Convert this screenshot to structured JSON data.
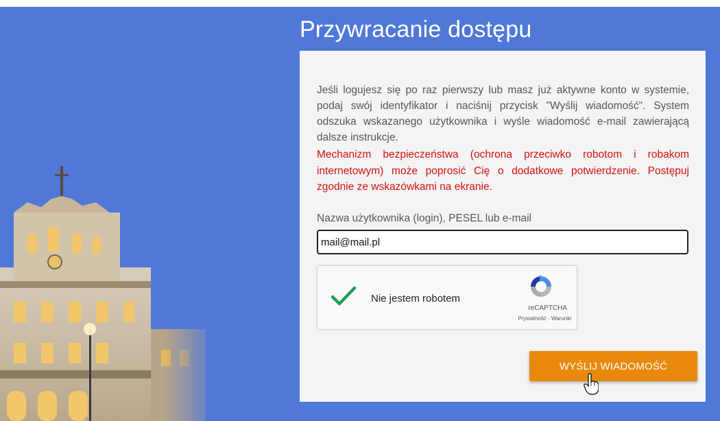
{
  "page": {
    "title": "Przywracanie dostępu",
    "intro_text": "Jeśli logujesz się po raz pierwszy lub masz już aktywne konto w systemie, podaj swój identyfikator i naciśnij przycisk \"Wyślij wiadomość\". System odszuka wskazanego użytkownika i wyśle wiadomość e-mail zawierającą dalsze instrukcje.",
    "warning_text": "Mechanizm bezpieczeństwa (ochrona przeciwko robotom i robakom internetowym) może poprosić Cię o dodatkowe potwierdzenie. Postępuj zgodnie ze wskazówkami na ekranie."
  },
  "form": {
    "login_label": "Nazwa użytkownika (login), PESEL lub e-mail",
    "login_value": "mail@mail.pl"
  },
  "recaptcha": {
    "label": "Nie jestem robotem",
    "brand": "reCAPTCHA",
    "privacy": "Prywatność",
    "separator": " - ",
    "terms": "Warunki",
    "checked": true
  },
  "actions": {
    "send_label": "WYŚLIJ WIADOMOŚĆ"
  },
  "colors": {
    "background": "#4f78d8",
    "panel": "#f4f4f4",
    "warning": "#d01010",
    "button": "#e8890c",
    "check": "#1e9e5a"
  }
}
